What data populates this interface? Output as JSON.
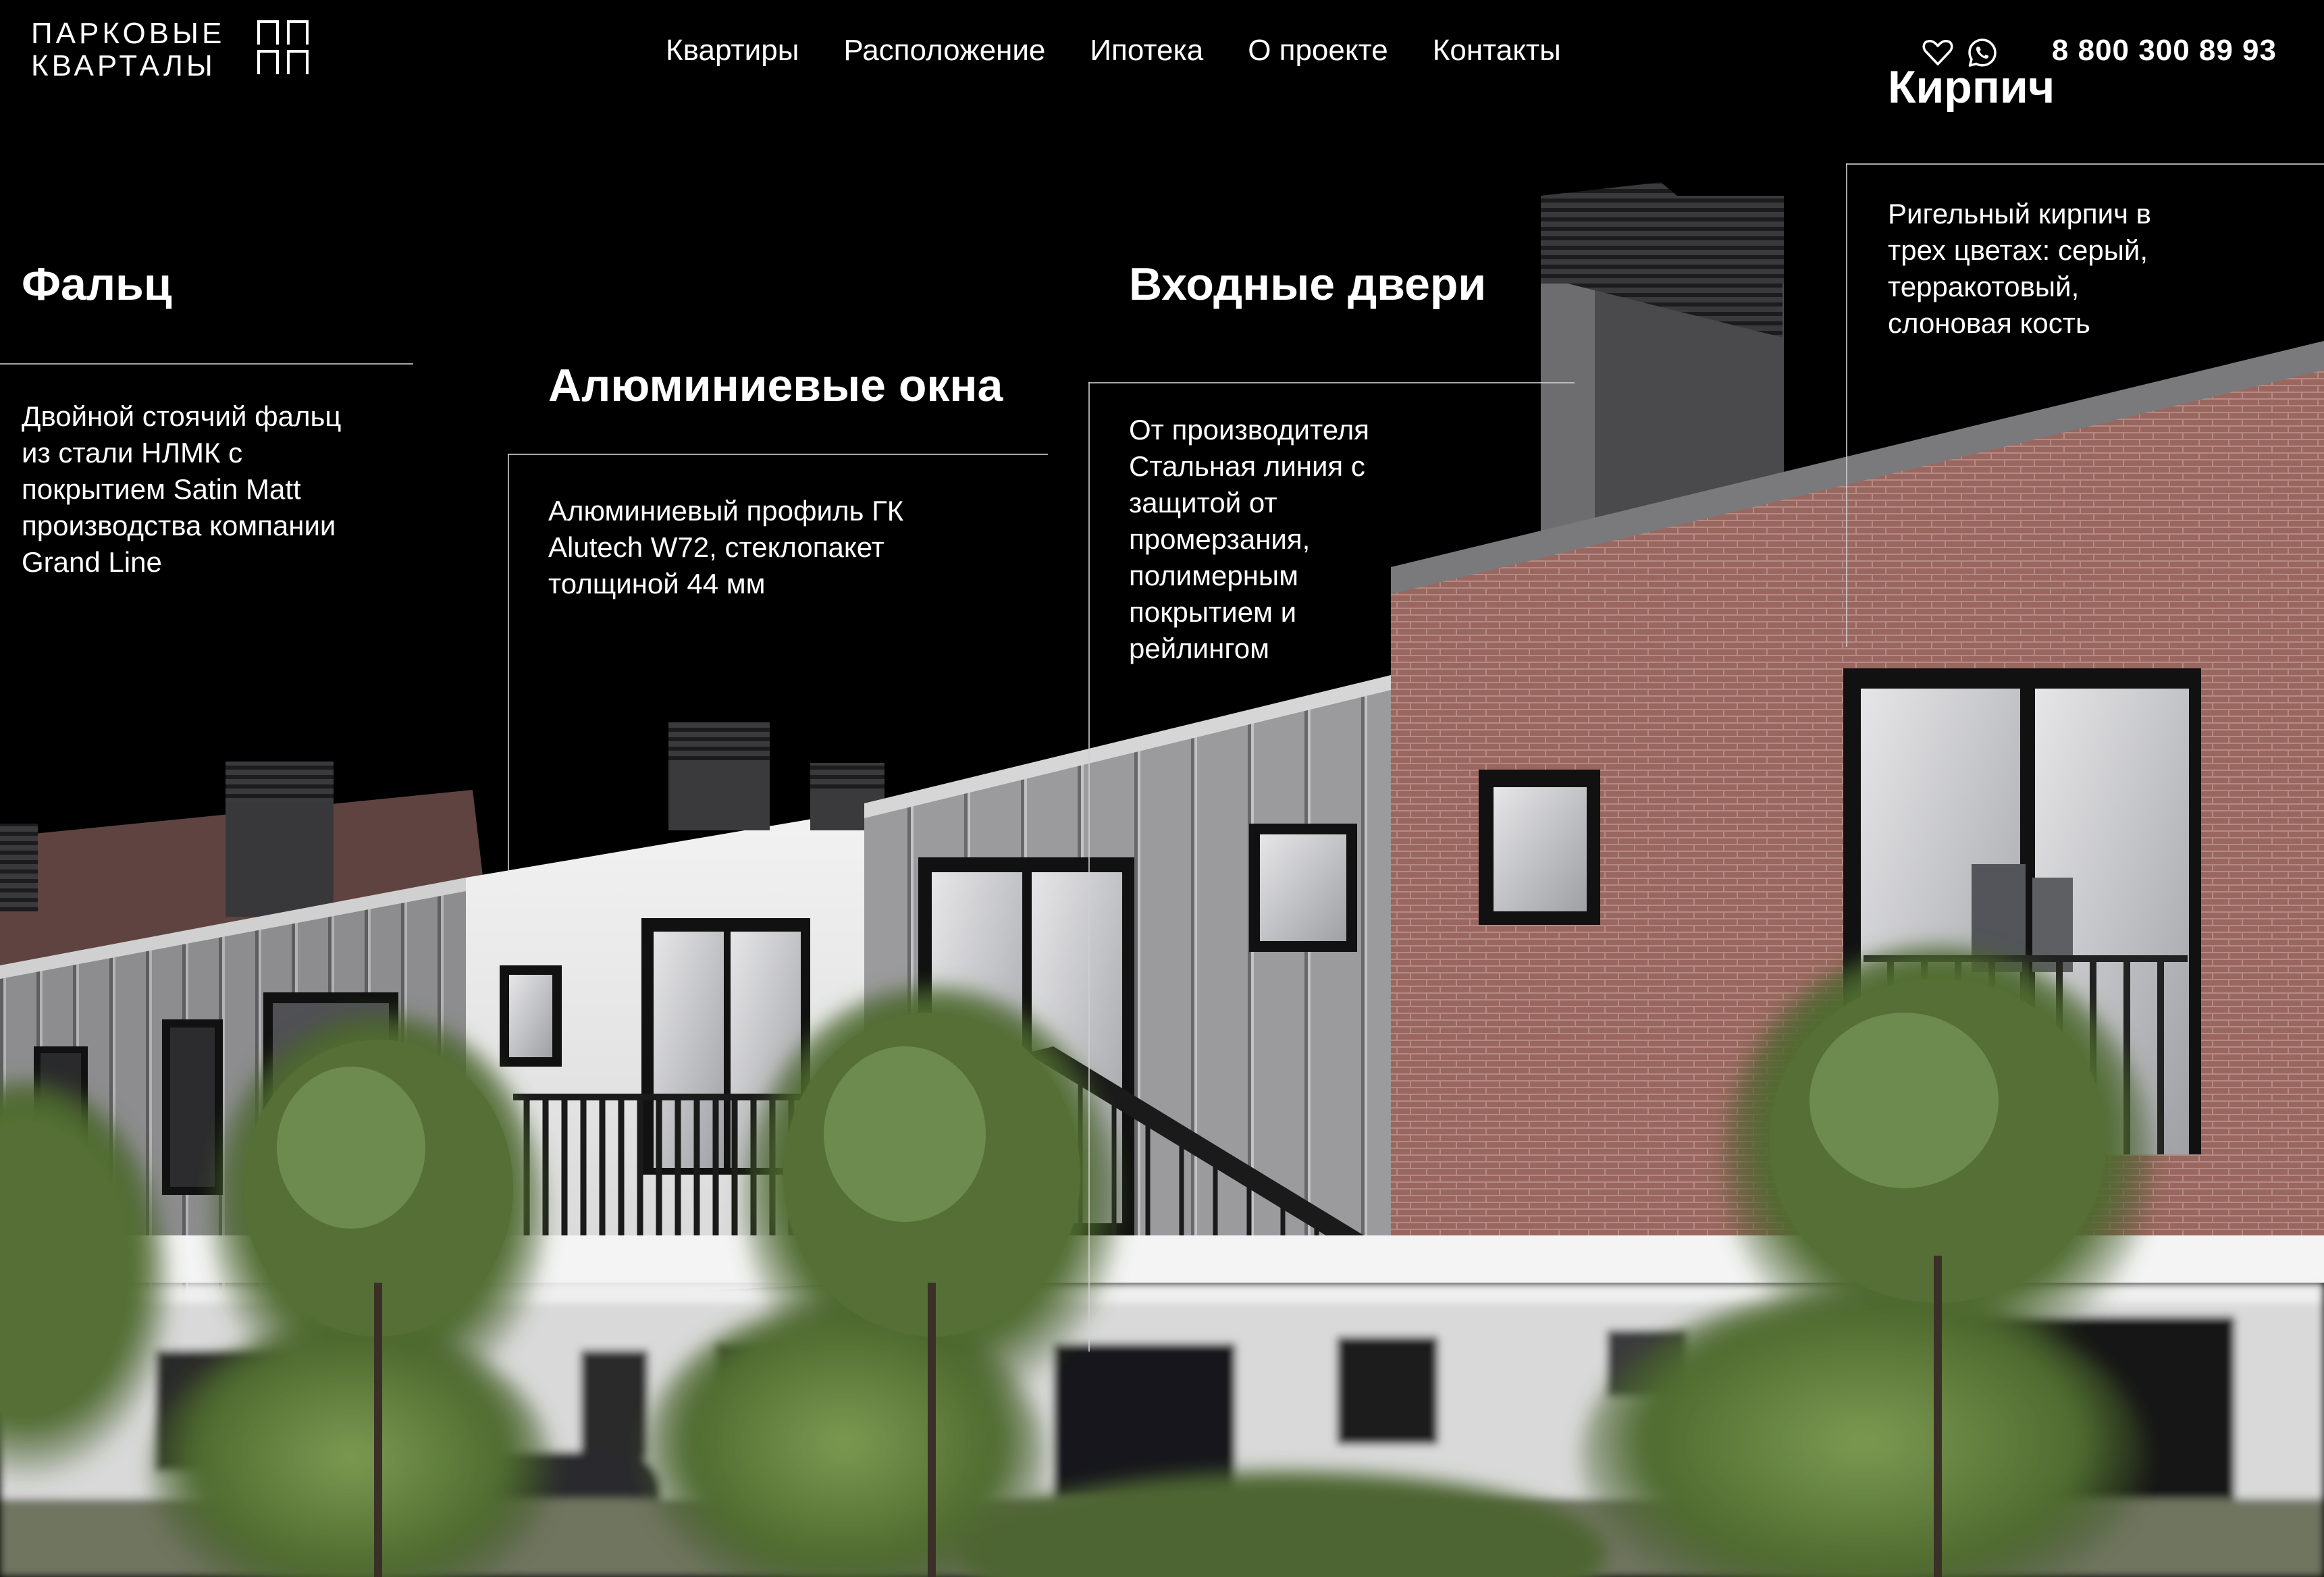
{
  "header": {
    "logo": {
      "line1": "ПАРКОВЫЕ",
      "line2": "КВАРТАЛЫ"
    },
    "nav": [
      {
        "label": "Квартиры"
      },
      {
        "label": "Расположение"
      },
      {
        "label": "Ипотека"
      },
      {
        "label": "О проекте"
      },
      {
        "label": "Контакты"
      }
    ],
    "icons": [
      "heart-icon",
      "whatsapp-icon"
    ],
    "phone": "8 800 300 89 93"
  },
  "features": [
    {
      "title": "Фальц",
      "text": "Двойной стоячий фальц\nиз стали НЛМК с\nпокрытием Satin Matt\nпроизводства компании\nGrand Line"
    },
    {
      "title": "Алюминиевые окна",
      "text": "Алюминиевый профиль ГК\nAlutech W72, стеклопакет\nтолщиной 44 мм"
    },
    {
      "title": "Входные двери",
      "text": "От производителя\nСтальная линия с\nзащитой от\nпромерзания,\nполимерным\nпокрытием и\nрейлингом"
    },
    {
      "title": "Кирпич",
      "text": "Ригельный кирпич в\nтрех цветах: серый,\nтерракотовый,\nслоновая кость"
    }
  ],
  "colors": {
    "background": "#000000",
    "text": "#ffffff",
    "brick": "#9a6760",
    "metal": "#8f8f90",
    "white_wall": "#ececec",
    "foliage": "#5f7d3c"
  }
}
